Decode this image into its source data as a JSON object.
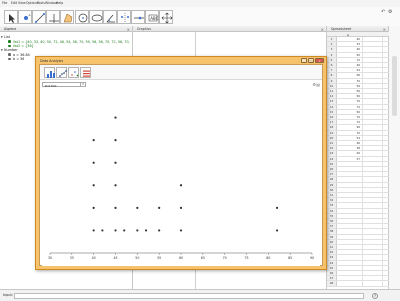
{
  "menu": [
    "File",
    "Edit",
    "View",
    "Options",
    "Tools",
    "Window",
    "Help"
  ],
  "toolbar_icons": [
    "move-tool-icon",
    "point-tool-icon",
    "line-tool-icon",
    "perpendicular-tool-icon",
    "polygon-tool-icon",
    "circle-tool-icon",
    "ellipse-tool-icon",
    "angle-tool-icon",
    "reflect-tool-icon",
    "slider-tool-icon",
    "text-tool-icon",
    "move-graphics-view-icon"
  ],
  "algebra": {
    "title": "Algebra",
    "groups": [
      {
        "label": "List",
        "items": [
          "list1 = {40, 33, 40, 50, 72, 46, 54, 56, 70, 59, 56, 56, 70, 72, 56, 70, 72, 56, 70}",
          "list2 = {36}"
        ]
      },
      {
        "label": "Number",
        "items": [
          "a = 36.84",
          "b = 36"
        ]
      }
    ]
  },
  "graphics": {
    "title": "Graphics"
  },
  "spreadsheet": {
    "title": "Spreadsheet",
    "column": "A",
    "rows": [
      "1",
      "2",
      "3",
      "4",
      "5",
      "6",
      "7",
      "8",
      "9",
      "10",
      "11",
      "12",
      "13",
      "14",
      "15",
      "16",
      "17",
      "18",
      "19",
      "20",
      "21",
      "22",
      "23",
      "24",
      "25",
      "26",
      "27",
      "28",
      "29",
      "30",
      "31",
      "32",
      "33",
      "34",
      "35",
      "36",
      "37",
      "38",
      "39",
      "40",
      "41",
      "42",
      "43",
      "44",
      "45",
      "46",
      "47",
      "48"
    ],
    "values": [
      "40",
      "33",
      "40",
      "50",
      "72",
      "46",
      "54",
      "56",
      "70",
      "59",
      "56",
      "56",
      "70",
      "72",
      "56",
      "70",
      "72",
      "56",
      "70",
      "54",
      "46",
      "38",
      "40",
      "37"
    ]
  },
  "dialog": {
    "title": "Data Analysis",
    "plot_type": "Dot Plot",
    "tools": [
      "one-variable-analysis-icon",
      "two-variable-analysis-icon",
      "multivariable-analysis-icon",
      "statistics-options-icon"
    ]
  },
  "chart_data": {
    "type": "scatter",
    "title": "",
    "xlabel": "",
    "ylabel": "",
    "x_ticks": [
      "30",
      "35",
      "40",
      "45",
      "50",
      "55",
      "60",
      "65",
      "70",
      "75",
      "80",
      "85",
      "90"
    ],
    "points": [
      {
        "x": 40,
        "y": 1
      },
      {
        "x": 40,
        "y": 2
      },
      {
        "x": 40,
        "y": 3
      },
      {
        "x": 40,
        "y": 4
      },
      {
        "x": 40,
        "y": 5
      },
      {
        "x": 42,
        "y": 1
      },
      {
        "x": 45,
        "y": 1
      },
      {
        "x": 45,
        "y": 2
      },
      {
        "x": 45,
        "y": 3
      },
      {
        "x": 45,
        "y": 4
      },
      {
        "x": 45,
        "y": 5
      },
      {
        "x": 45,
        "y": 6
      },
      {
        "x": 47,
        "y": 1
      },
      {
        "x": 50,
        "y": 1
      },
      {
        "x": 50,
        "y": 2
      },
      {
        "x": 52,
        "y": 1
      },
      {
        "x": 55,
        "y": 1
      },
      {
        "x": 55,
        "y": 2
      },
      {
        "x": 60,
        "y": 1
      },
      {
        "x": 60,
        "y": 2
      },
      {
        "x": 60,
        "y": 3
      },
      {
        "x": 82,
        "y": 1
      },
      {
        "x": 82,
        "y": 2
      }
    ],
    "xlim": [
      30,
      90
    ],
    "ylim": [
      0,
      7
    ],
    "grid": false
  },
  "input": {
    "label": "Input:"
  },
  "colors": {
    "dialog_frame": "#f6c36c",
    "accent": "#3a6fd0"
  }
}
